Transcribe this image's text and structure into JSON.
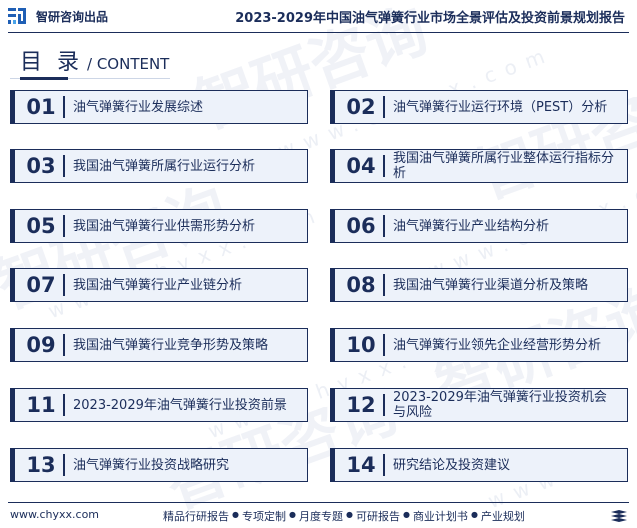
{
  "header": {
    "brand": "智研咨询出品",
    "report_title": "2023-2029年中国油气弹簧行业市场全景评估及投资前景规划报告",
    "logo_icon": "zhiyan-logo-icon"
  },
  "toc": {
    "title_zh": "目 录",
    "title_en": "/ CONTENT",
    "items": [
      {
        "num": "01",
        "label": "油气弹簧行业发展综述"
      },
      {
        "num": "02",
        "label": "油气弹簧行业运行环境（PEST）分析"
      },
      {
        "num": "03",
        "label": "我国油气弹簧所属行业运行分析"
      },
      {
        "num": "04",
        "label": "我国油气弹簧所属行业整体运行指标分析"
      },
      {
        "num": "05",
        "label": "我国油气弹簧行业供需形势分析"
      },
      {
        "num": "06",
        "label": "油气弹簧行业产业结构分析"
      },
      {
        "num": "07",
        "label": "我国油气弹簧行业产业链分析"
      },
      {
        "num": "08",
        "label": "我国油气弹簧行业渠道分析及策略"
      },
      {
        "num": "09",
        "label": "我国油气弹簧行业竞争形势及策略"
      },
      {
        "num": "10",
        "label": "油气弹簧行业领先企业经营形势分析"
      },
      {
        "num": "11",
        "label": "2023-2029年油气弹簧行业投资前景"
      },
      {
        "num": "12",
        "label": "2023-2029年油气弹簧行业投资机会与风险"
      },
      {
        "num": "13",
        "label": "油气弹簧行业投资战略研究"
      },
      {
        "num": "14",
        "label": "研究结论及投资建议"
      }
    ]
  },
  "watermark": {
    "text_zh": "智研咨询",
    "text_url": "www.chyxx.com"
  },
  "footer": {
    "url": "www.chyxx.com",
    "services": [
      "精品行研报告",
      "专项定制",
      "月度专题",
      "可研报告",
      "商业计划书",
      "产业规划"
    ],
    "separator": "●",
    "end_icon": "stack-icon"
  },
  "colors": {
    "primary": "#1b2d5a",
    "card_fill": "#edf2fa",
    "underline_grey": "#cdd6e6"
  }
}
